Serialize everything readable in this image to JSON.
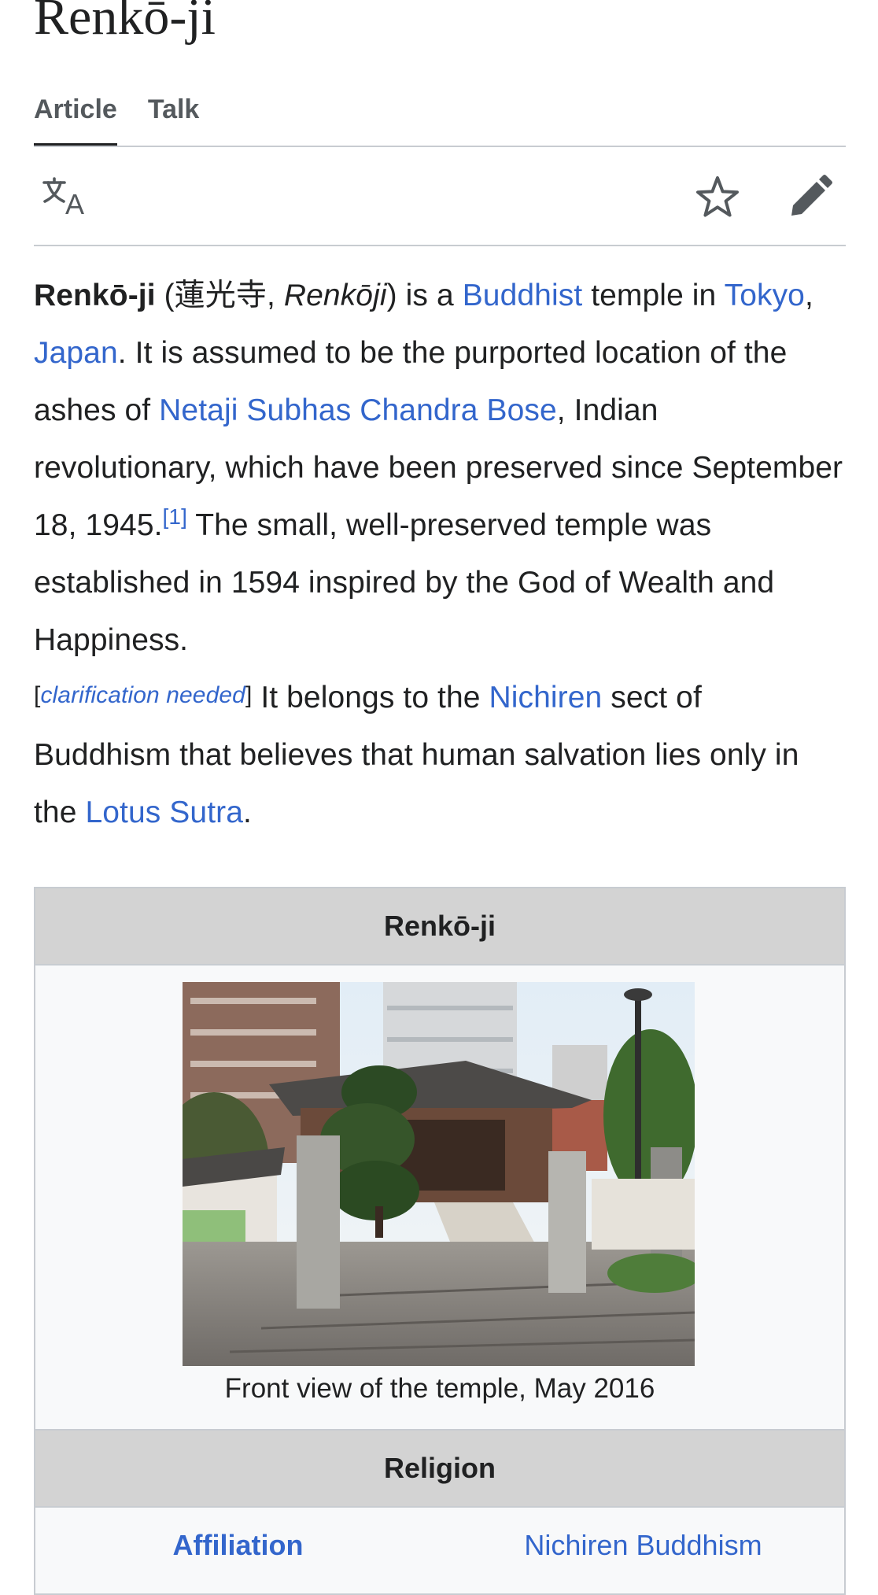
{
  "page": {
    "title": "Renkō-ji",
    "tabs": [
      {
        "label": "Article",
        "active": true
      },
      {
        "label": "Talk",
        "active": false
      }
    ],
    "toolbar": {
      "language_icon": "translate-icon",
      "watch_icon": "star-icon",
      "edit_icon": "pencil-icon"
    }
  },
  "lead": {
    "title_bold": "Renkō-ji",
    "paren_open": " (蓮光寺, ",
    "romaji": "Renkōji",
    "paren_close": ") is a ",
    "link_buddhist": "Buddhist",
    "t_temple_in": " temple in ",
    "link_tokyo": "Tokyo",
    "comma": ", ",
    "link_japan": "Japan",
    "t_assumed": ". It is assumed to be the purported location of the ashes of ",
    "link_bose": "Netaji Subhas Chandra Bose",
    "t_revolutionary": ", Indian revolutionary, which have been preserved since September 18, 1945.",
    "ref1": "[1]",
    "t_small": " The small, well-preserved temple was established in 1594 inspired by the God of Wealth and Happiness.",
    "clar_open": "[",
    "clar_text": "clarification needed",
    "clar_close": "]",
    "t_belongs": " It belongs to the ",
    "link_nichiren": "Nichiren",
    "t_sect": " sect of Buddhism that believes that human salvation lies only in the ",
    "link_lotus": "Lotus Sutra",
    "period": "."
  },
  "infobox": {
    "title": "Renkō-ji",
    "caption": "Front view of the temple, May 2016",
    "section_religion": "Religion",
    "affiliation_label": "Affiliation",
    "affiliation_value": "Nichiren Buddhism"
  },
  "colors": {
    "link": "#3366cc",
    "text": "#202122",
    "infobox_header": "#d3d3d3",
    "infobox_bg": "#f8f9fa"
  }
}
